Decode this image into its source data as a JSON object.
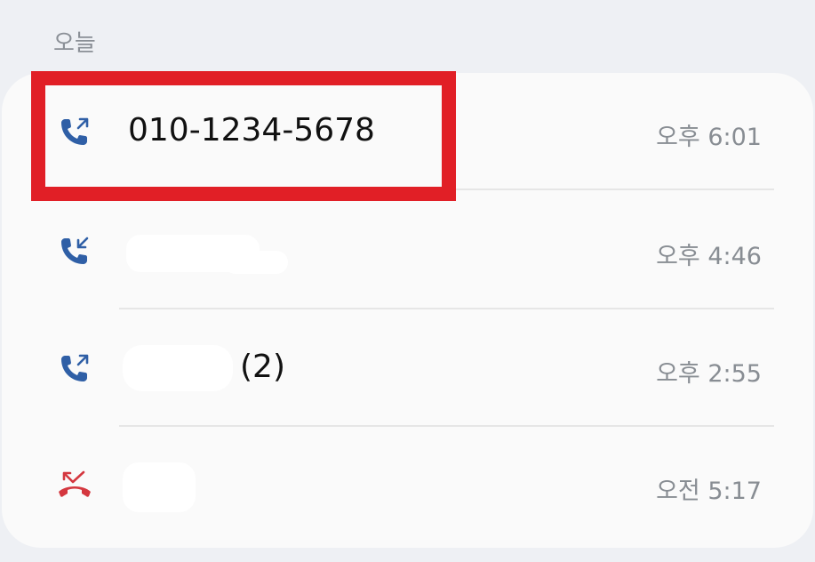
{
  "section": {
    "title": "오늘"
  },
  "calls": [
    {
      "name": "010-1234-5678",
      "time": "오후 6:01",
      "type": "outgoing",
      "icon": "outgoing-call-icon"
    },
    {
      "name": "",
      "time": "오후 4:46",
      "type": "incoming",
      "icon": "incoming-call-icon"
    },
    {
      "name": "",
      "count": "(2)",
      "time": "오후 2:55",
      "type": "outgoing",
      "icon": "outgoing-call-icon"
    },
    {
      "name": "",
      "time": "오전 5:17",
      "type": "missed",
      "icon": "missed-call-icon"
    }
  ],
  "colors": {
    "call_icon": "#2f5fa6",
    "missed_icon": "#d4373f",
    "highlight": "#e11f26",
    "background": "#eef0f4",
    "card": "#fafafa"
  }
}
